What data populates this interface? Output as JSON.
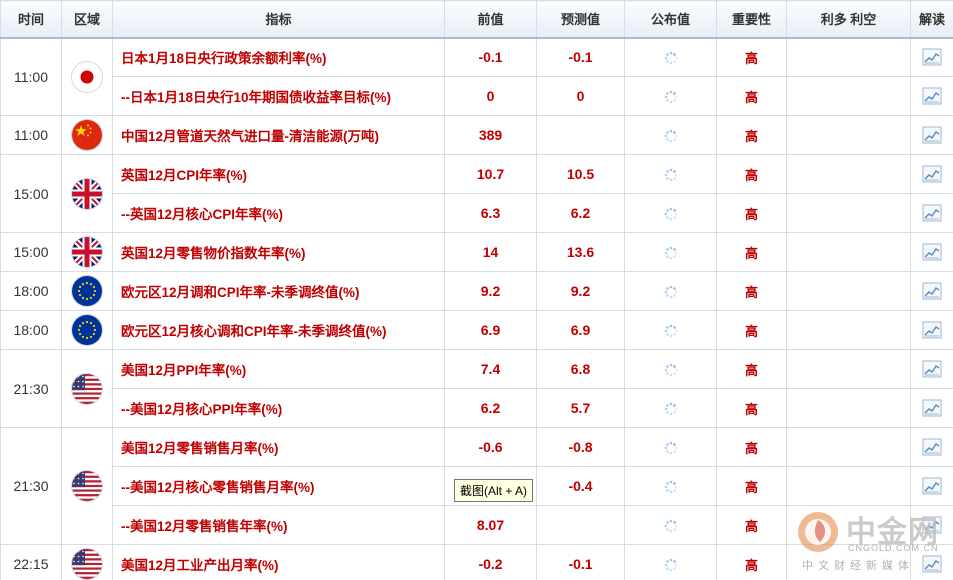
{
  "header": {
    "time": "时间",
    "region": "区域",
    "indicator": "指标",
    "previous": "前值",
    "forecast": "预测值",
    "actual": "公布值",
    "importance": "重要性",
    "bull_bear": "利多 利空",
    "analysis": "解读"
  },
  "groups": [
    {
      "time": "11:00",
      "flag": "jp",
      "rows": [
        {
          "indicator": "日本1月18日央行政策余额利率(%)",
          "previous": "-0.1",
          "forecast": "-0.1",
          "importance": "高"
        },
        {
          "indicator": "--日本1月18日央行10年期国债收益率目标(%)",
          "previous": "0",
          "forecast": "0",
          "importance": "高"
        }
      ]
    },
    {
      "time": "11:00",
      "flag": "cn",
      "rows": [
        {
          "indicator": "中国12月管道天然气进口量-清洁能源(万吨)",
          "previous": "389",
          "forecast": "",
          "importance": "高"
        }
      ]
    },
    {
      "time": "15:00",
      "flag": "uk",
      "rows": [
        {
          "indicator": "英国12月CPI年率(%)",
          "previous": "10.7",
          "forecast": "10.5",
          "importance": "高"
        },
        {
          "indicator": "--英国12月核心CPI年率(%)",
          "previous": "6.3",
          "forecast": "6.2",
          "importance": "高"
        }
      ]
    },
    {
      "time": "15:00",
      "flag": "uk",
      "rows": [
        {
          "indicator": "英国12月零售物价指数年率(%)",
          "previous": "14",
          "forecast": "13.6",
          "importance": "高"
        }
      ]
    },
    {
      "time": "18:00",
      "flag": "eu",
      "rows": [
        {
          "indicator": "欧元区12月调和CPI年率-未季调终值(%)",
          "previous": "9.2",
          "forecast": "9.2",
          "importance": "高"
        }
      ]
    },
    {
      "time": "18:00",
      "flag": "eu",
      "rows": [
        {
          "indicator": "欧元区12月核心调和CPI年率-未季调终值(%)",
          "previous": "6.9",
          "forecast": "6.9",
          "importance": "高"
        }
      ]
    },
    {
      "time": "21:30",
      "flag": "us",
      "rows": [
        {
          "indicator": "美国12月PPI年率(%)",
          "previous": "7.4",
          "forecast": "6.8",
          "importance": "高"
        },
        {
          "indicator": "--美国12月核心PPI年率(%)",
          "previous": "6.2",
          "forecast": "5.7",
          "importance": "高"
        }
      ]
    },
    {
      "time": "21:30",
      "flag": "us",
      "rows": [
        {
          "indicator": "美国12月零售销售月率(%)",
          "previous": "-0.6",
          "forecast": "-0.8",
          "importance": "高"
        },
        {
          "indicator": "--美国12月核心零售销售月率(%)",
          "previous": "",
          "forecast": "-0.4",
          "importance": "高"
        },
        {
          "indicator": "--美国12月零售销售年率(%)",
          "previous": "8.07",
          "forecast": "",
          "importance": "高"
        }
      ]
    },
    {
      "time": "22:15",
      "flag": "us",
      "rows": [
        {
          "indicator": "美国12月工业产出月率(%)",
          "previous": "-0.2",
          "forecast": "-0.1",
          "importance": "高"
        }
      ]
    }
  ],
  "tooltip": "截图(Alt + A)",
  "watermark": {
    "name": "中金网",
    "domain": "CNGOLD.COM.CN",
    "slogan": "中文财经新媒体"
  },
  "icons": {
    "loading": "loading-spinner-icon",
    "analysis": "chart-analysis-icon"
  },
  "colors": {
    "accent_red": "#c00000",
    "header_border": "#a9bfd8",
    "grid": "#d5dde8"
  }
}
